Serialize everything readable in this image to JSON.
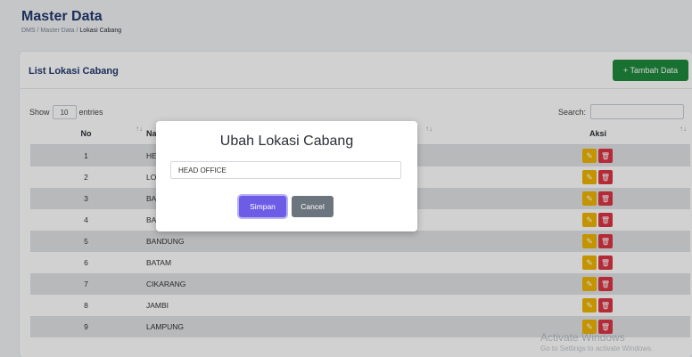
{
  "header": {
    "title": "Master Data",
    "breadcrumb": {
      "root": "DMS",
      "sep": "/",
      "mid": "Master Data",
      "current": "Lokasi Cabang"
    }
  },
  "card": {
    "title": "List Lokasi Cabang",
    "add_button": "+ Tambah Data",
    "show_label": "Show",
    "entries_value": "10",
    "entries_label": "entries",
    "search_label": "Search:"
  },
  "table": {
    "columns": {
      "no": "No",
      "name": "Na",
      "aksi": "Aksi"
    },
    "rows": [
      {
        "no": "1",
        "name": "HE"
      },
      {
        "no": "2",
        "name": "LO"
      },
      {
        "no": "3",
        "name": "BA"
      },
      {
        "no": "4",
        "name": "BA"
      },
      {
        "no": "5",
        "name": "BANDUNG"
      },
      {
        "no": "6",
        "name": "BATAM"
      },
      {
        "no": "7",
        "name": "CIKARANG"
      },
      {
        "no": "8",
        "name": "JAMBI"
      },
      {
        "no": "9",
        "name": "LAMPUNG"
      }
    ]
  },
  "modal": {
    "title": "Ubah Lokasi Cabang",
    "input_value": "HEAD OFFICE",
    "save_label": "Simpan",
    "cancel_label": "Cancel"
  },
  "watermark": {
    "line1": "Activate Windows",
    "line2": "Go to Settings to activate Windows."
  },
  "colors": {
    "accent": "#233a6e",
    "add_button": "#1f8a3c",
    "edit_button": "#f0b400",
    "delete_button": "#dc3545",
    "save_button": "#6d5ce6",
    "cancel_button": "#6c757d"
  }
}
